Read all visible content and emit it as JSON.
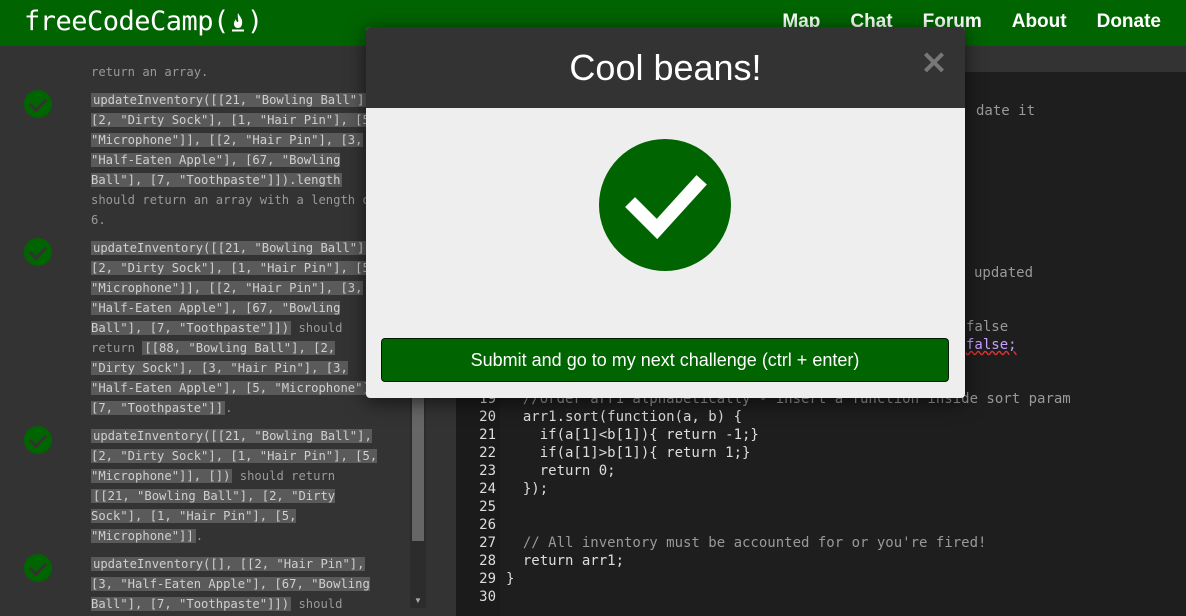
{
  "navbar": {
    "brand": "freeCodeCamp(",
    "brand_close": ")",
    "links": [
      "Map",
      "Chat",
      "Forum",
      "About",
      "Donate"
    ]
  },
  "instructions": {
    "top_fragment": "return an array.",
    "tests": [
      {
        "code": "updateInventory([[21, \"Bowling Ball\"], [2, \"Dirty Sock\"], [1, \"Hair Pin\"], [5, \"Microphone\"]], [[2, \"Hair Pin\"], [3, \"Half-Eaten Apple\"], [67, \"Bowling Ball\"], [7, \"Toothpaste\"]]).length",
        "text": " should return an array with a length of 6."
      },
      {
        "code": "updateInventory([[21, \"Bowling Ball\"], [2, \"Dirty Sock\"], [1, \"Hair Pin\"], [5, \"Microphone\"]], [[2, \"Hair Pin\"], [3, \"Half-Eaten Apple\"], [67, \"Bowling Ball\"], [7, \"Toothpaste\"]])",
        "text": " should return ",
        "code2": "[[88, \"Bowling Ball\"], [2, \"Dirty Sock\"], [3, \"Hair Pin\"], [3, \"Half-Eaten Apple\"], [5, \"Microphone\"], [7, \"Toothpaste\"]]",
        "text2": "."
      },
      {
        "code": "updateInventory([[21, \"Bowling Ball\"], [2, \"Dirty Sock\"], [1, \"Hair Pin\"], [5, \"Microphone\"]], [])",
        "text": " should return ",
        "code2": "[[21, \"Bowling Ball\"], [2, \"Dirty Sock\"], [1, \"Hair Pin\"], [5, \"Microphone\"]]",
        "text2": "."
      },
      {
        "code": "updateInventory([], [[2, \"Hair Pin\"], [3, \"Half-Eaten Apple\"], [67, \"Bowling Ball\"], [7, \"Toothpaste\"]])",
        "text": " should"
      }
    ]
  },
  "editor": {
    "behind_fragments": [
      "date it",
      "updated",
      "false",
      "false;"
    ],
    "lines": [
      {
        "n": "19",
        "code": "  //order arr1 alphabetically - insert a function inside sort param"
      },
      {
        "n": "20",
        "code": "  arr1.sort(function(a, b) {"
      },
      {
        "n": "21",
        "code": "    if(a[1]<b[1]){ return -1;}"
      },
      {
        "n": "22",
        "code": "    if(a[1]>b[1]){ return 1;}"
      },
      {
        "n": "23",
        "code": "    return 0;"
      },
      {
        "n": "24",
        "code": "  });"
      },
      {
        "n": "25",
        "code": ""
      },
      {
        "n": "26",
        "code": ""
      },
      {
        "n": "27",
        "code": "  // All inventory must be accounted for or you're fired!"
      },
      {
        "n": "28",
        "code": "  return arr1;"
      },
      {
        "n": "29",
        "code": "}"
      },
      {
        "n": "30",
        "code": ""
      }
    ]
  },
  "modal": {
    "title": "Cool beans!",
    "close": "×",
    "submit_label": "Submit and go to my next challenge (ctrl + enter)"
  },
  "colors": {
    "brand_green": "#006400",
    "background": "#333333"
  }
}
